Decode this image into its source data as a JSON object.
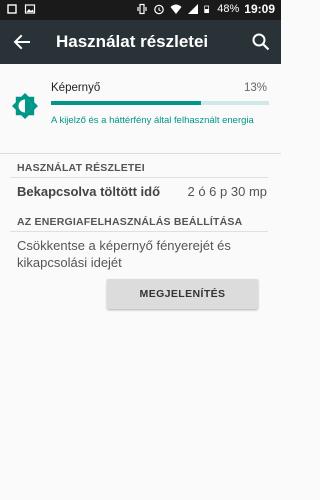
{
  "status_bar": {
    "battery": "48%",
    "time": "19:09"
  },
  "toolbar": {
    "title": "Használat részletei"
  },
  "usage": {
    "app_name": "Képernyő",
    "percent_label": "13%",
    "percent_value": 0.69,
    "description": "A kijelző és a háttérfény által felhasznált energia",
    "accent_color": "#009688"
  },
  "sections": {
    "usage_details_header": "HASZNÁLAT RÉSZLETEI",
    "usage_detail_label": "Bekapcsolva töltött idő",
    "usage_detail_value": "2 ó 6 p 30 mp",
    "power_settings_header": "AZ ENERGIAFELHASZNÁLÁS BEÁLLÍTÁSA",
    "power_tip": "Csökkentse a képernyő fényerejét és kikapcsolási idejét",
    "show_button_label": "MEGJELENÍTÉS"
  }
}
